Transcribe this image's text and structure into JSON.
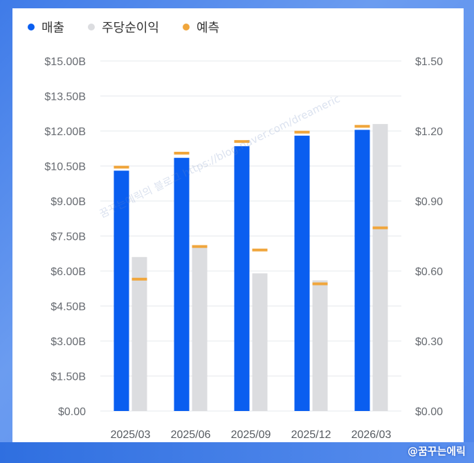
{
  "legend": [
    {
      "label": "매출",
      "color": "#0a5ef0"
    },
    {
      "label": "주당순이익",
      "color": "#dcdde0"
    },
    {
      "label": "예측",
      "color": "#f0a63c"
    }
  ],
  "credit": "@꿈꾸는에릭",
  "watermark": "꿈꾸는에릭의 블로그 https://blog.naver.com/dreameric",
  "chart_data": {
    "type": "bar",
    "categories": [
      "2025/03",
      "2025/06",
      "2025/09",
      "2025/12",
      "2026/03"
    ],
    "y_left": {
      "ylim": [
        0,
        15
      ],
      "ticks": [
        "$0.00",
        "$1.50B",
        "$3.00B",
        "$4.50B",
        "$6.00B",
        "$7.50B",
        "$9.00B",
        "$10.50B",
        "$12.00B",
        "$13.50B",
        "$15.00B"
      ]
    },
    "y_right": {
      "ylim": [
        0,
        1.5
      ],
      "ticks": [
        "$0.00",
        "$0.30",
        "$0.60",
        "$0.90",
        "$1.20",
        "$1.50"
      ]
    },
    "series": [
      {
        "name": "매출",
        "axis": "left",
        "color": "#0a5ef0",
        "values": [
          10.3,
          10.85,
          11.35,
          11.8,
          12.05
        ],
        "forecast": [
          10.45,
          11.05,
          11.55,
          11.95,
          12.2
        ]
      },
      {
        "name": "주당순이익",
        "axis": "right",
        "color": "#dcdde0",
        "values": [
          0.66,
          0.71,
          0.59,
          0.56,
          1.23
        ],
        "forecast": [
          0.565,
          0.705,
          0.69,
          0.545,
          0.785
        ]
      }
    ],
    "forecast_color": "#f0a63c",
    "grid": true,
    "legend_position": "top-left"
  }
}
